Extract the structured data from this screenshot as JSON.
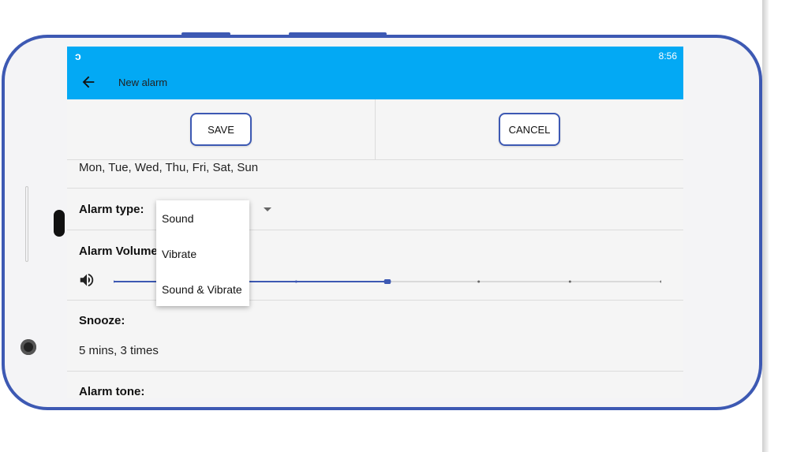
{
  "status": {
    "time": "8:56",
    "logo": "ↄ"
  },
  "toolbar": {
    "title": "New alarm"
  },
  "actions": {
    "save_label": "SAVE",
    "cancel_label": "CANCEL"
  },
  "days": {
    "value": "Mon, Tue, Wed, Thu, Fri, Sat, Sun"
  },
  "alarm_type": {
    "label": "Alarm type:",
    "options": [
      "Sound",
      "Vibrate",
      "Sound & Vibrate"
    ]
  },
  "volume": {
    "label": "Alarm Volume:",
    "level": 0.5,
    "steps": 7
  },
  "snooze": {
    "label": "Snooze:",
    "value": "5 mins, 3 times"
  },
  "tone": {
    "label": "Alarm tone:"
  },
  "colors": {
    "accent": "#03a9f4",
    "frame": "#3d59b3"
  }
}
